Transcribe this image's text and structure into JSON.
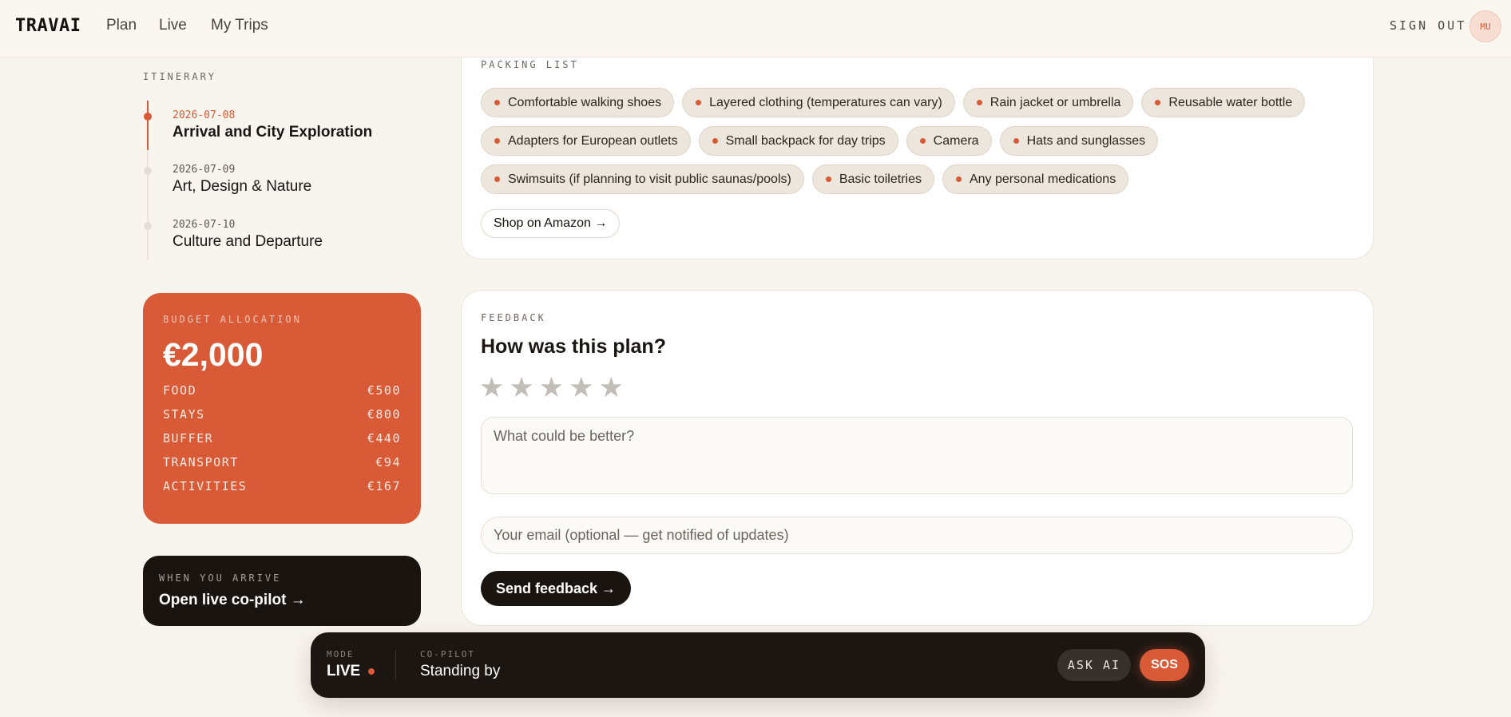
{
  "header": {
    "logo": "TRAVAI",
    "nav": [
      {
        "label": "Plan"
      },
      {
        "label": "Live"
      },
      {
        "label": "My Trips"
      }
    ],
    "sign_out": "SIGN OUT",
    "avatar_initials": "MU"
  },
  "itinerary": {
    "label": "ITINERARY",
    "days": [
      {
        "date": "2026-07-08",
        "title": "Arrival and City Exploration",
        "active": true
      },
      {
        "date": "2026-07-09",
        "title": "Art, Design & Nature",
        "active": false
      },
      {
        "date": "2026-07-10",
        "title": "Culture and Departure",
        "active": false
      }
    ]
  },
  "budget": {
    "label": "BUDGET ALLOCATION",
    "total": "€2,000",
    "items": [
      {
        "name": "FOOD",
        "amount": "€500"
      },
      {
        "name": "STAYS",
        "amount": "€800"
      },
      {
        "name": "BUFFER",
        "amount": "€440"
      },
      {
        "name": "TRANSPORT",
        "amount": "€94"
      },
      {
        "name": "ACTIVITIES",
        "amount": "€167"
      }
    ]
  },
  "arrive": {
    "label": "WHEN YOU ARRIVE",
    "cta": "Open live co-pilot →"
  },
  "packing": {
    "label": "PACKING LIST",
    "items": [
      "Comfortable walking shoes",
      "Layered clothing (temperatures can vary)",
      "Rain jacket or umbrella",
      "Reusable water bottle",
      "Adapters for European outlets",
      "Small backpack for day trips",
      "Camera",
      "Hats and sunglasses",
      "Swimsuits (if planning to visit public saunas/pools)",
      "Basic toiletries",
      "Any personal medications"
    ],
    "shop_label": "Shop on Amazon →"
  },
  "feedback": {
    "label": "FEEDBACK",
    "title": "How was this plan?",
    "stars": [
      "★",
      "★",
      "★",
      "★",
      "★"
    ],
    "rating": 0,
    "textarea_placeholder": "What could be better?",
    "email_placeholder": "Your email (optional — get notified of updates)",
    "send_label": "Send feedback →"
  },
  "livebar": {
    "mode_label": "MODE",
    "mode": "LIVE",
    "copilot_label": "CO-PILOT",
    "copilot_status": "Standing by",
    "ask_label": "ASK AI",
    "sos_label": "SOS"
  },
  "colors": {
    "accent": "#d85a36",
    "dark": "#1a1410",
    "background": "#f8f4ee"
  }
}
